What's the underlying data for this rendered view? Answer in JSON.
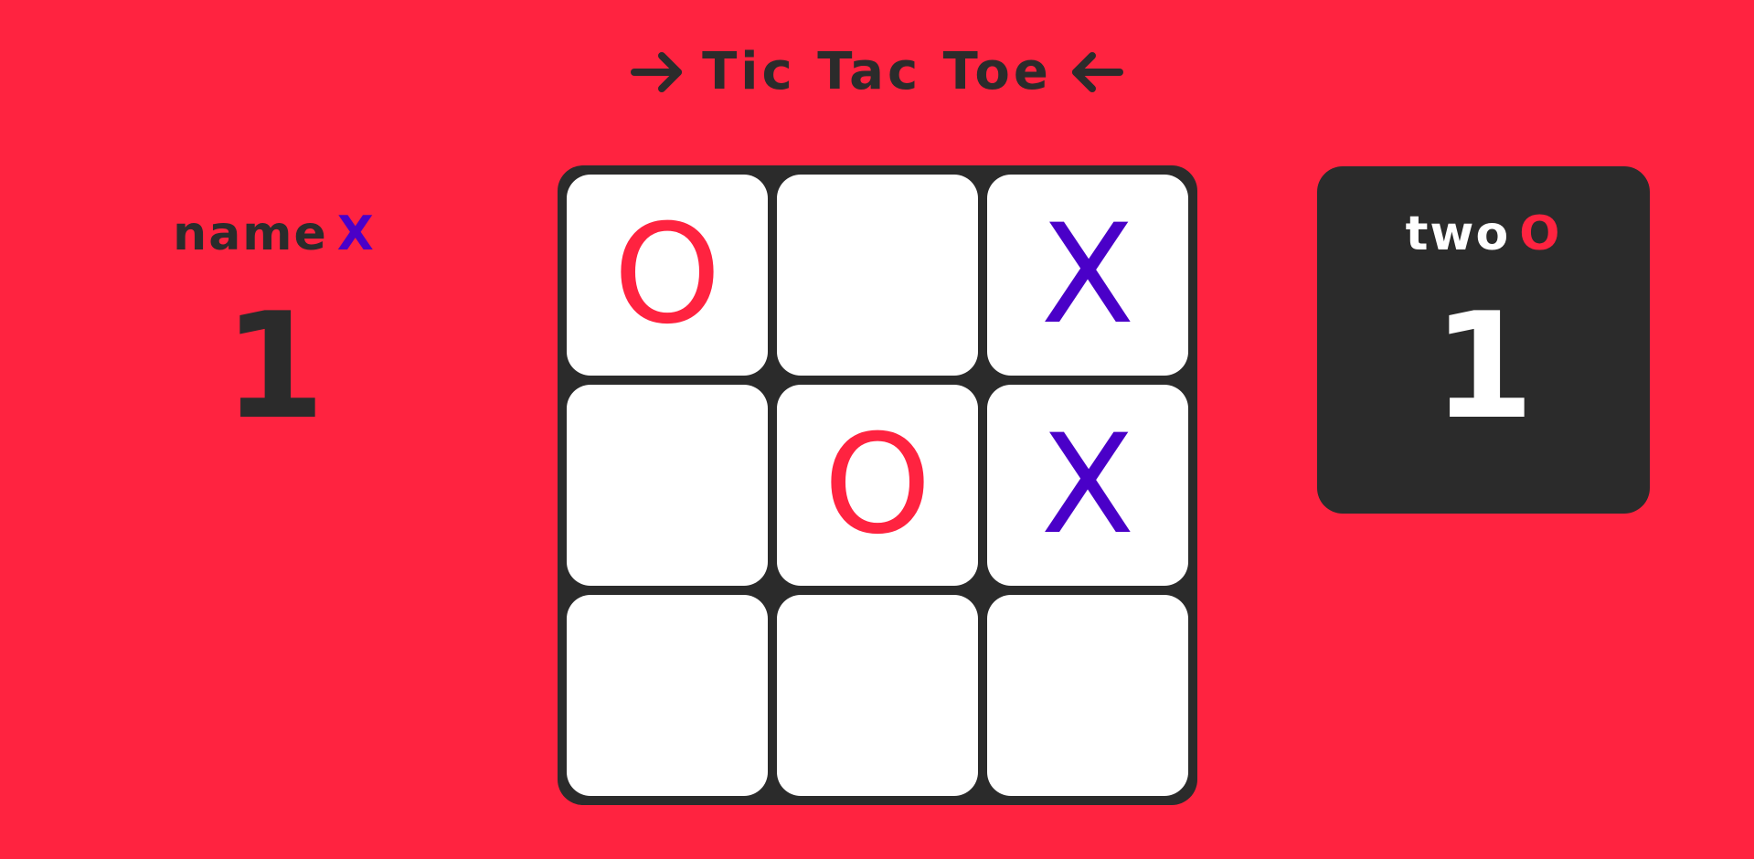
{
  "title": "Tic Tac Toe",
  "colors": {
    "background": "#FF2340",
    "dark": "#2B2B2B",
    "x_mark": "#4A00C8",
    "o_mark": "#FF2340",
    "cell": "#FFFFFF"
  },
  "players": [
    {
      "name": "name",
      "mark": "X",
      "score": "1",
      "active": false
    },
    {
      "name": "two",
      "mark": "O",
      "score": "1",
      "active": true
    }
  ],
  "board": [
    "O",
    "",
    "X",
    "",
    "O",
    "X",
    "",
    "",
    ""
  ],
  "icons": {
    "left_arrow": "arrow-right-icon",
    "right_arrow": "arrow-left-icon"
  }
}
